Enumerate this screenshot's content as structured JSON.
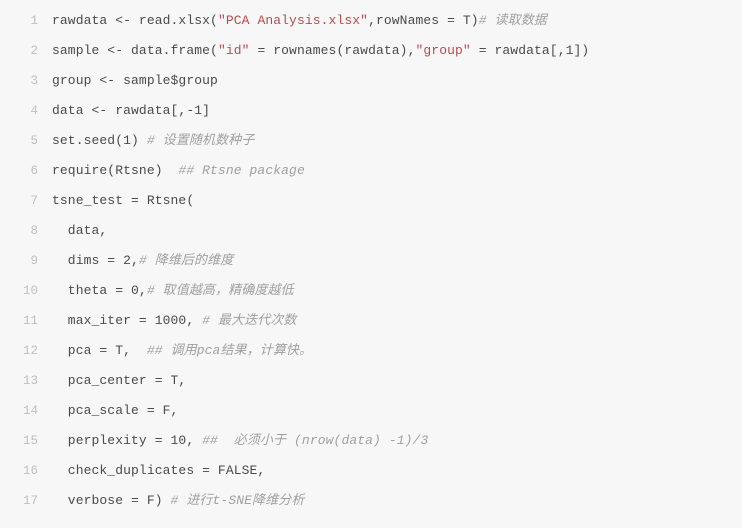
{
  "lines": [
    {
      "n": 1,
      "tokens": [
        {
          "t": "rawdata <- read.xlsx(",
          "c": "tok-default"
        },
        {
          "t": "\"PCA Analysis.xlsx\"",
          "c": "tok-string"
        },
        {
          "t": ",rowNames = T)",
          "c": "tok-default"
        },
        {
          "t": "# 读取数据",
          "c": "tok-comment"
        }
      ]
    },
    {
      "n": 2,
      "tokens": [
        {
          "t": "sample <- data.frame(",
          "c": "tok-default"
        },
        {
          "t": "\"id\"",
          "c": "tok-string"
        },
        {
          "t": " = rownames(rawdata),",
          "c": "tok-default"
        },
        {
          "t": "\"group\"",
          "c": "tok-string"
        },
        {
          "t": " = rawdata[,1])",
          "c": "tok-default"
        }
      ]
    },
    {
      "n": 3,
      "tokens": [
        {
          "t": "group <- sample$group",
          "c": "tok-default"
        }
      ]
    },
    {
      "n": 4,
      "tokens": [
        {
          "t": "data <- rawdata[,-1]",
          "c": "tok-default"
        }
      ]
    },
    {
      "n": 5,
      "tokens": [
        {
          "t": "set.seed(1) ",
          "c": "tok-default"
        },
        {
          "t": "# 设置随机数种子",
          "c": "tok-comment"
        }
      ]
    },
    {
      "n": 6,
      "tokens": [
        {
          "t": "require(Rtsne)  ",
          "c": "tok-default"
        },
        {
          "t": "## Rtsne package",
          "c": "tok-comment"
        }
      ]
    },
    {
      "n": 7,
      "tokens": [
        {
          "t": "tsne_test = Rtsne(",
          "c": "tok-default"
        }
      ]
    },
    {
      "n": 8,
      "tokens": [
        {
          "t": "  data,",
          "c": "tok-default"
        }
      ]
    },
    {
      "n": 9,
      "tokens": [
        {
          "t": "  dims = 2,",
          "c": "tok-default"
        },
        {
          "t": "# 降维后的维度",
          "c": "tok-comment"
        }
      ]
    },
    {
      "n": 10,
      "tokens": [
        {
          "t": "  theta = 0,",
          "c": "tok-default"
        },
        {
          "t": "# 取值越高，精确度越低",
          "c": "tok-comment"
        }
      ]
    },
    {
      "n": 11,
      "tokens": [
        {
          "t": "  max_iter = 1000, ",
          "c": "tok-default"
        },
        {
          "t": "# 最大迭代次数",
          "c": "tok-comment"
        }
      ]
    },
    {
      "n": 12,
      "tokens": [
        {
          "t": "  pca = T,  ",
          "c": "tok-default"
        },
        {
          "t": "## 调用pca结果，计算快。",
          "c": "tok-comment"
        }
      ]
    },
    {
      "n": 13,
      "tokens": [
        {
          "t": "  pca_center = T,",
          "c": "tok-default"
        }
      ]
    },
    {
      "n": 14,
      "tokens": [
        {
          "t": "  pca_scale = F,",
          "c": "tok-default"
        }
      ]
    },
    {
      "n": 15,
      "tokens": [
        {
          "t": "  perplexity = 10, ",
          "c": "tok-default"
        },
        {
          "t": "##  必须小于 (nrow(data) -1)/3",
          "c": "tok-comment"
        }
      ]
    },
    {
      "n": 16,
      "tokens": [
        {
          "t": "  check_duplicates = FALSE,",
          "c": "tok-default"
        }
      ]
    },
    {
      "n": 17,
      "tokens": [
        {
          "t": "  verbose = F) ",
          "c": "tok-default"
        },
        {
          "t": "# 进行t-SNE降维分析",
          "c": "tok-comment"
        }
      ]
    }
  ]
}
